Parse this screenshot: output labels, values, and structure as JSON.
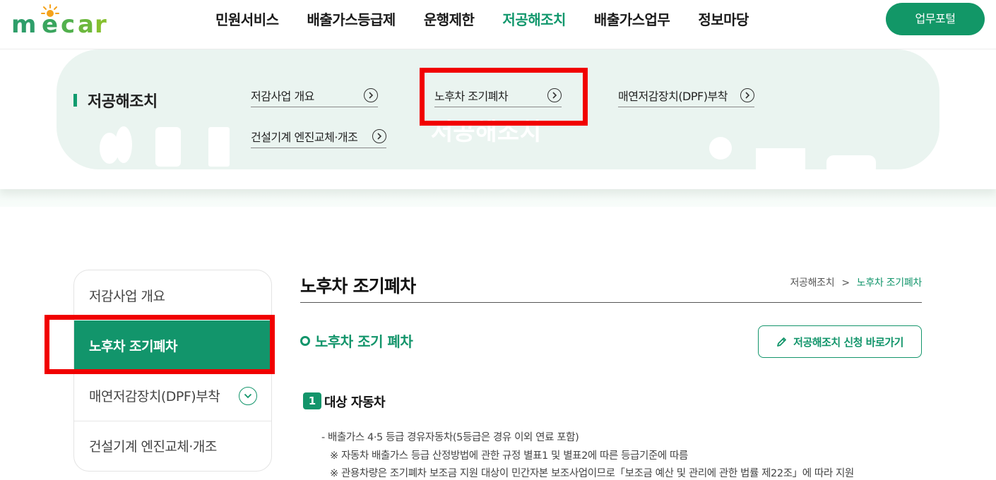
{
  "brand": {
    "logo_text": "mecar",
    "accent": "#12956b",
    "highlight": "#f10000"
  },
  "header": {
    "nav": [
      "민원서비스",
      "배출가스등급제",
      "운행제한",
      "저공해조치",
      "배출가스업무",
      "정보마당"
    ],
    "active_index": 3,
    "portal_button": "업무포털"
  },
  "mega_menu": {
    "title": "저공해조치",
    "links": [
      "저감사업 개요",
      "노후차 조기폐차",
      "매연저감장치(DPF)부착",
      "건설기계 엔진교체·개조"
    ],
    "watermark": "저공해조치"
  },
  "sidebar": {
    "items": [
      "저감사업 개요",
      "노후차 조기폐차",
      "매연저감장치(DPF)부착",
      "건설기계 엔진교체·개조"
    ],
    "active_index": 1
  },
  "content": {
    "page_title": "노후차 조기폐차",
    "breadcrumb": {
      "parent": "저공해조치",
      "separator": ">",
      "current": "노후차 조기폐차"
    },
    "section_title": "노후차 조기 폐차",
    "apply_button": "저공해조치 신청 바로가기",
    "item_number": "1",
    "item_title": "대상 자동차",
    "lines": [
      "- 배출가스 4·5 등급 경유자동차(5등급은 경유 이외 연료 포함)",
      "※ 자동차 배출가스 등급 산정방법에 관한 규정 별표1 및 별표2에 따른 등급기준에 따름",
      "※ 관용차량은 조기폐차 보조금 지원 대상이 민간자본 보조사업이므로「보조금 예산 및 관리에 관한 법률 제22조」에 따라 지원"
    ]
  }
}
